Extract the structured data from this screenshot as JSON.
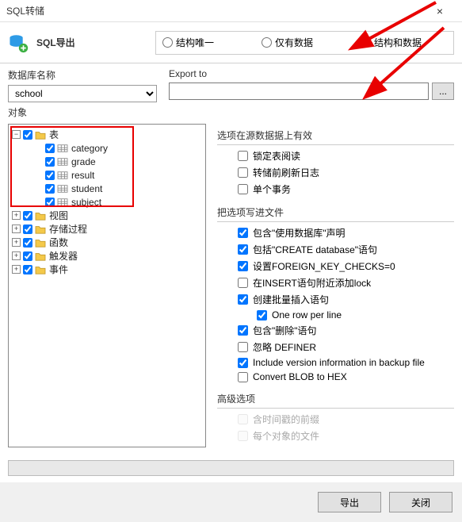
{
  "titlebar": {
    "title": "SQL转储",
    "close": "×"
  },
  "header": {
    "export_label": "SQL导出",
    "radios": {
      "structure_only": "结构唯一",
      "data_only": "仅有数据",
      "structure_and_data": "结构和数据"
    }
  },
  "labels": {
    "db_name": "数据库名称",
    "export_to": "Export to",
    "objects": "对象",
    "browse": "..."
  },
  "db_value": "school",
  "export_path": "",
  "tree": {
    "top": {
      "label": "表",
      "children": [
        "category",
        "grade",
        "result",
        "student",
        "subject"
      ]
    },
    "others": [
      "视图",
      "存储过程",
      "函数",
      "触发器",
      "事件"
    ]
  },
  "sections": {
    "s1_title": "选项在源数据据上有效",
    "s1": {
      "lock_tables": "锁定表阅读",
      "flush_logs": "转储前刷新日志",
      "single_tx": "单个事务"
    },
    "s2_title": "把选项写进文件",
    "s2": {
      "use_db": "包含\"使用数据库\"声明",
      "create_db": "包括\"CREATE database\"语句",
      "fk_checks": "设置FOREIGN_KEY_CHECKS=0",
      "insert_lock": "在INSERT语句附近添加lock",
      "bulk_insert": "创建批量插入语句",
      "one_row": "One row per line",
      "del_stmt": "包含\"删除\"语句",
      "ignore_definer": "忽略 DEFINER",
      "version_info": "Include version information in backup file",
      "blob_hex": "Convert BLOB to HEX"
    },
    "s3_title": "高级选项",
    "s3": {
      "ts_prefix": "含时间戳的前缀",
      "per_object_file": "每个对象的文件"
    }
  },
  "buttons": {
    "export": "导出",
    "close": "关闭"
  }
}
